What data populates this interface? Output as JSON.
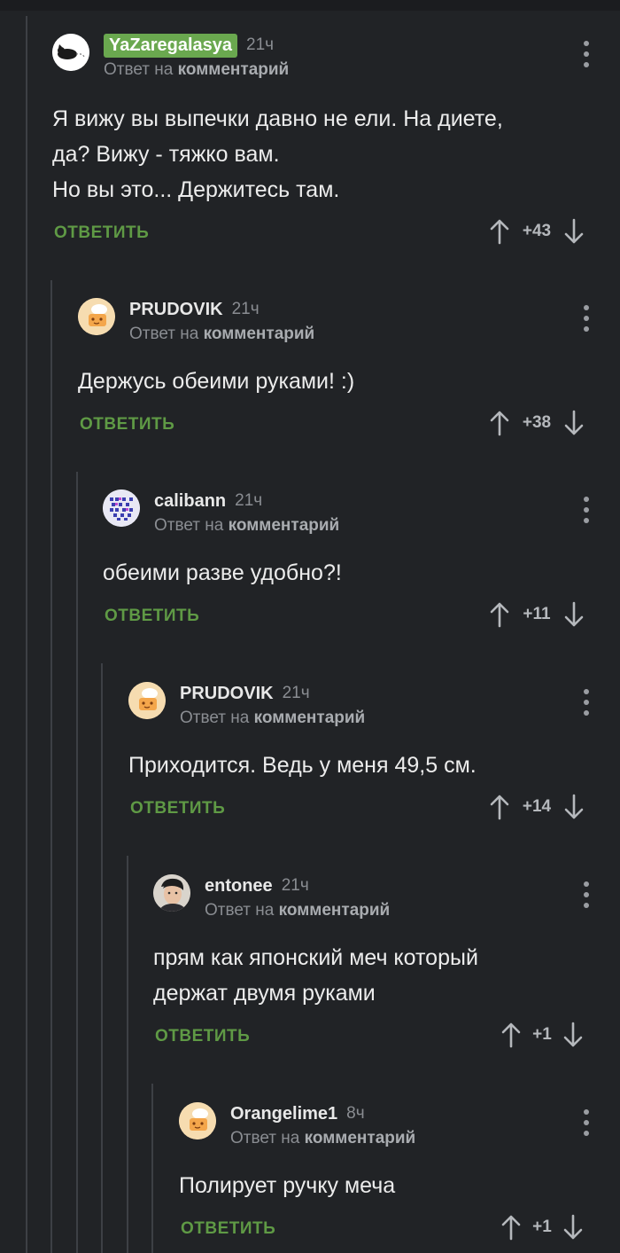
{
  "comments": [
    {
      "author": "YaZaregalasya",
      "time": "21ч",
      "reply_prefix": "Ответ на",
      "reply_target": "комментарий",
      "text": "Я вижу вы выпечки давно не ели. На диете,\nда? Вижу - тяжко вам.\nНо вы это... Держитесь там.",
      "reply_label": "ОТВЕТИТЬ",
      "score": "+43",
      "avatar": "cat-avatar"
    },
    {
      "author": "PRUDOVIK",
      "time": "21ч",
      "reply_prefix": "Ответ на",
      "reply_target": "комментарий",
      "text": "Держусь обеими руками! :)",
      "reply_label": "ОТВЕТИТЬ",
      "score": "+38",
      "avatar": "chef-avatar"
    },
    {
      "author": "calibann",
      "time": "21ч",
      "reply_prefix": "Ответ на",
      "reply_target": "комментарий",
      "text": "обеими разве удобно?!",
      "reply_label": "ОТВЕТИТЬ",
      "score": "+11",
      "avatar": "pixel-avatar"
    },
    {
      "author": "PRUDOVIK",
      "time": "21ч",
      "reply_prefix": "Ответ на",
      "reply_target": "комментарий",
      "text": "Приходится. Ведь у меня 49,5 см.",
      "reply_label": "ОТВЕТИТЬ",
      "score": "+14",
      "avatar": "chef-avatar"
    },
    {
      "author": "entonee",
      "time": "21ч",
      "reply_prefix": "Ответ на",
      "reply_target": "комментарий",
      "text": "прям как японский меч который\nдержат двумя руками",
      "reply_label": "ОТВЕТИТЬ",
      "score": "+1",
      "avatar": "photo-avatar"
    },
    {
      "author": "Orangelime1",
      "time": "8ч",
      "reply_prefix": "Ответ на",
      "reply_target": "комментарий",
      "text": "Полирует ручку меча",
      "reply_label": "ОТВЕТИТЬ",
      "score": "+1",
      "avatar": "chef-avatar"
    }
  ],
  "colors": {
    "background": "#212326",
    "accent_green": "#5f9a45",
    "badge_green": "#6aa84f",
    "thread_line": "#3d4045"
  }
}
